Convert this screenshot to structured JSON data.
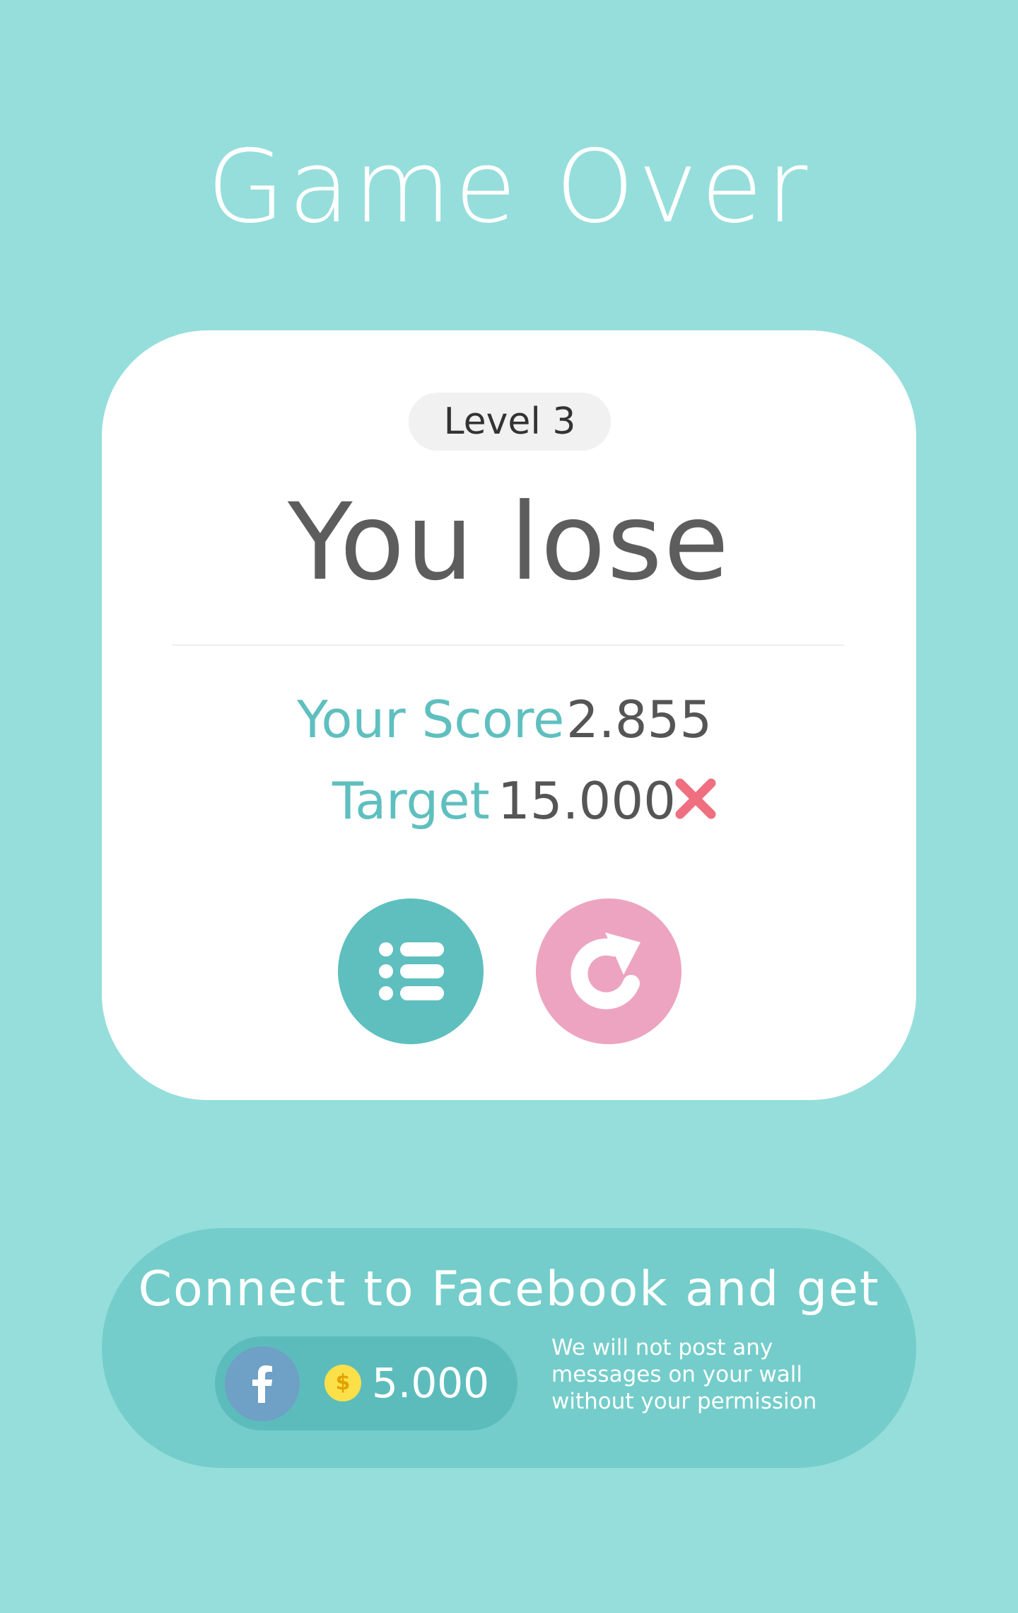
{
  "screen": {
    "title": "Game Over"
  },
  "result_card": {
    "level_label": "Level 3",
    "result_text": "You lose",
    "score_label": "Your Score",
    "score_value": "2.855",
    "target_label": "Target",
    "target_value": "15.000",
    "target_status_icon": "cross-icon",
    "buttons": {
      "menu_icon": "list-icon",
      "retry_icon": "restart-icon"
    }
  },
  "facebook": {
    "headline": "Connect to Facebook and get",
    "reward_amount": "5.000",
    "note_lines": [
      "We will not post  any",
      "messages on your wall",
      "without your permission"
    ],
    "icon": "facebook-icon",
    "coin_icon": "coin-icon",
    "coin_symbol": "$"
  },
  "colors": {
    "background": "#95dedb",
    "card": "#ffffff",
    "teal_accent": "#5fbfbf",
    "pink_accent": "#eda4c0",
    "fail_red": "#ef6f80",
    "facebook_blue": "#6fa0c5",
    "coin_yellow": "#fbe04a"
  }
}
